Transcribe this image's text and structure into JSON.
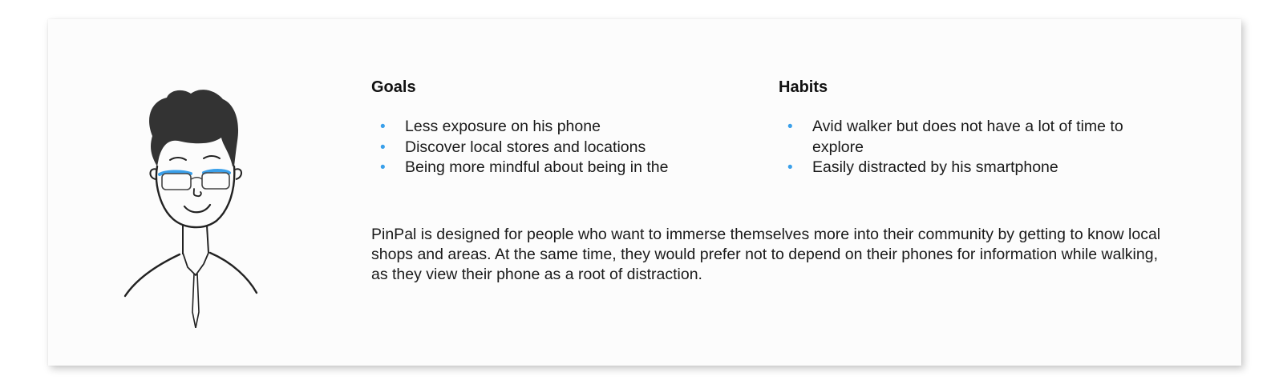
{
  "persona": {
    "avatar_icon": "person-with-glasses-illustration",
    "accent_color": "#3aa0ea",
    "goals": {
      "title": "Goals",
      "items": [
        "Less exposure on his phone",
        "Discover local stores and locations",
        "Being more mindful about being in the"
      ]
    },
    "habits": {
      "title": "Habits",
      "items": [
        "Avid walker but does not have a lot of time to explore",
        "Easily distracted by his smartphone"
      ]
    },
    "summary": "PinPal is designed for people who want to immerse themselves more into their community by getting to know local shops and areas. At the same time, they would prefer not to depend on their phones for information while walking, as they view their phone as a root of distraction."
  }
}
